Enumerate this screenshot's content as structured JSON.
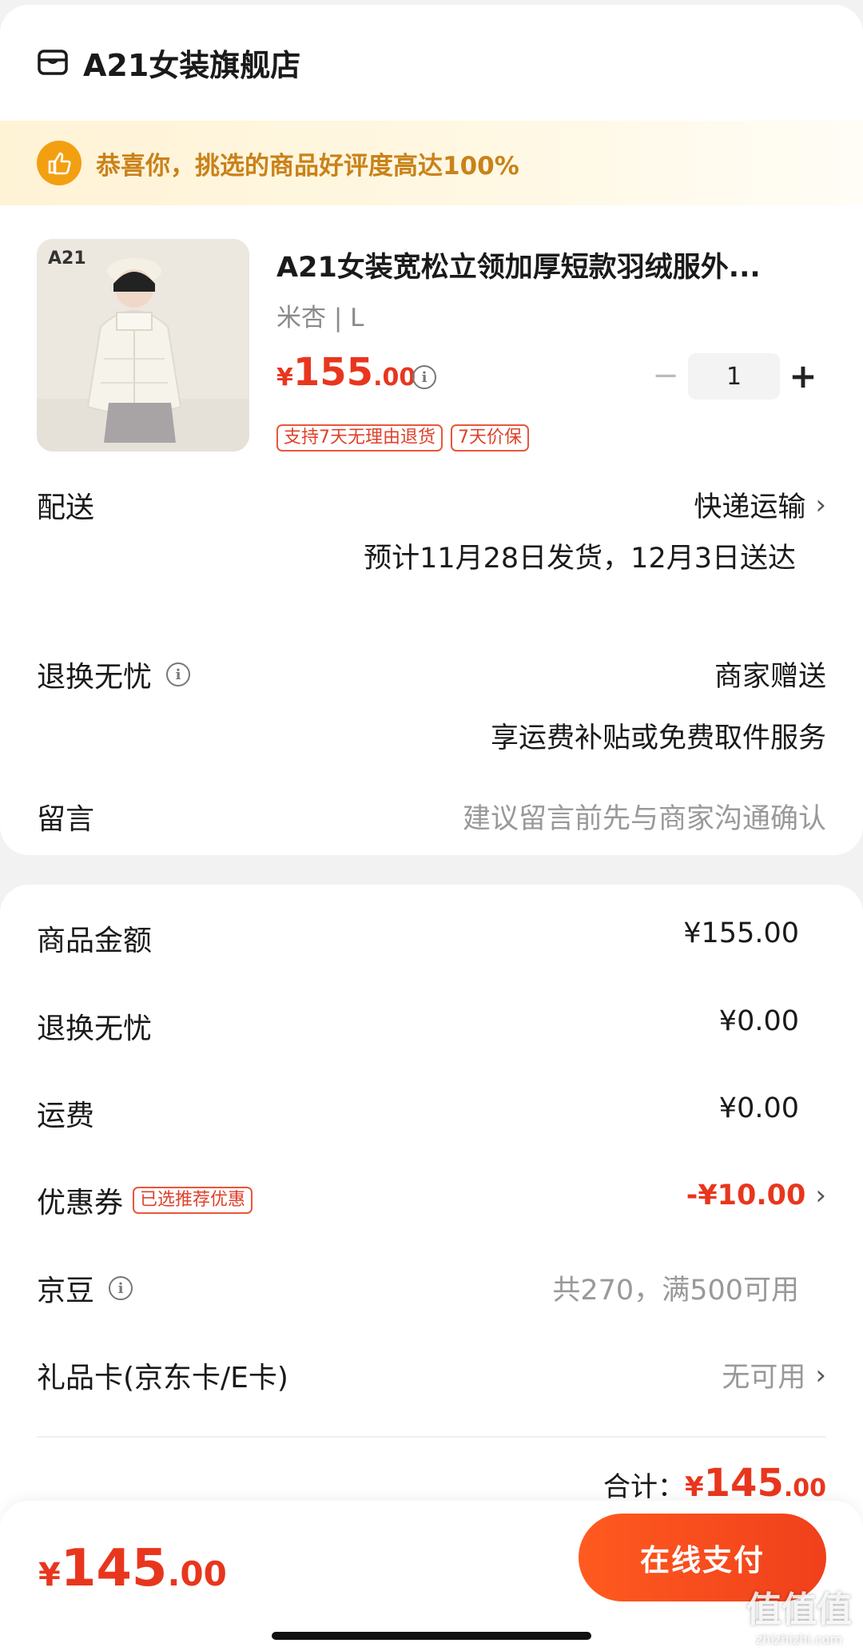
{
  "store": {
    "name": "A21女装旗舰店",
    "icon": "store-icon"
  },
  "banner": {
    "text": "恭喜你，挑选的商品好评度高达100%",
    "icon": "thumbs-up-icon"
  },
  "product": {
    "image_brand": "A21",
    "title": "A21女装宽松立领加厚短款羽绒服外...",
    "spec": "米杏 | L",
    "price_currency": "¥",
    "price_int": "155",
    "price_dec": ".00",
    "quantity": "1",
    "minus_label": "−",
    "plus_label": "+",
    "tags": [
      "支持7天无理由退货",
      "7天价保"
    ]
  },
  "delivery": {
    "label": "配送",
    "method": "快递运输",
    "estimate": "预计11月28日发货，12月3日送达"
  },
  "return_service": {
    "label": "退换无忧",
    "value": "商家赠送",
    "desc": "享运费补贴或免费取件服务"
  },
  "message": {
    "label": "留言",
    "placeholder": "建议留言前先与商家沟通确认"
  },
  "summary_rows": {
    "goods_amount": {
      "label": "商品金额",
      "value": "¥155.00"
    },
    "return_fee": {
      "label": "退换无忧",
      "value": "¥0.00"
    },
    "shipping": {
      "label": "运费",
      "value": "¥0.00"
    },
    "coupon": {
      "label": "优惠券",
      "badge": "已选推荐优惠",
      "value": "-¥10.00"
    },
    "jd_beans": {
      "label": "京豆",
      "value": "共270，满500可用"
    },
    "gift_card": {
      "label": "礼品卡(京东卡/E卡)",
      "value": "无可用"
    }
  },
  "subtotal": {
    "label": "合计：",
    "currency": "¥",
    "int": "145",
    "dec": ".00"
  },
  "bottom": {
    "currency": "¥",
    "int": "145",
    "dec": ".00",
    "pay_label": "在线支付"
  },
  "watermark": {
    "big": "值值值",
    "small": "zhizhizhi.com"
  },
  "colors": {
    "accent": "#e8361e",
    "banner_text": "#c9821a",
    "tag_border": "#e9563b"
  }
}
